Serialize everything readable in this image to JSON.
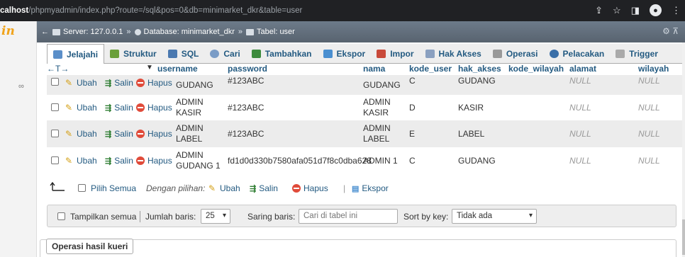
{
  "browser": {
    "url_host": "calhost",
    "url_path": "/phpmyadmin/index.php?route=/sql&pos=0&db=minimarket_dkr&table=user"
  },
  "sidebar": {
    "logo": "in"
  },
  "breadcrumb": {
    "server": "Server: 127.0.0.1",
    "database": "Database: minimarket_dkr",
    "table": "Tabel: user",
    "sep": "»"
  },
  "tabs": [
    {
      "label": "Jelajahi",
      "icon": "browse-icon",
      "color": "#5b8fc9"
    },
    {
      "label": "Struktur",
      "icon": "structure-icon",
      "color": "#6a9f3a"
    },
    {
      "label": "SQL",
      "icon": "sql-icon",
      "color": "#4b79b0"
    },
    {
      "label": "Cari",
      "icon": "search-icon",
      "color": "#7a9cc6"
    },
    {
      "label": "Tambahkan",
      "icon": "insert-icon",
      "color": "#3d8b3d"
    },
    {
      "label": "Ekspor",
      "icon": "export-icon",
      "color": "#4a8fd0"
    },
    {
      "label": "Impor",
      "icon": "import-icon",
      "color": "#c94a3a"
    },
    {
      "label": "Hak Akses",
      "icon": "privileges-icon",
      "color": "#8aa0c0"
    },
    {
      "label": "Operasi",
      "icon": "operations-icon",
      "color": "#999999"
    },
    {
      "label": "Pelacakan",
      "icon": "tracking-icon",
      "color": "#3a6fa8"
    },
    {
      "label": "Trigger",
      "icon": "trigger-icon",
      "color": "#aaaaaa"
    }
  ],
  "table": {
    "arrows": "←T→",
    "headers": [
      "username",
      "password",
      "nama",
      "kode_user",
      "hak_akses",
      "kode_wilayah",
      "alamat",
      "wilayah"
    ],
    "actions": {
      "edit": "Ubah",
      "copy": "Salin",
      "delete": "Hapus"
    },
    "rows": [
      {
        "username": "GUDANG",
        "password": "#123ABC",
        "nama": "GUDANG",
        "kode_user": "C",
        "hak_akses": "GUDANG",
        "alamat": "NULL",
        "wilayah": "NULL"
      },
      {
        "username": "ADMIN KASIR",
        "password": "#123ABC",
        "nama": "ADMIN KASIR",
        "kode_user": "D",
        "hak_akses": "KASIR",
        "alamat": "NULL",
        "wilayah": "NULL"
      },
      {
        "username": "ADMIN LABEL",
        "password": "#123ABC",
        "nama": "ADMIN LABEL",
        "kode_user": "E",
        "hak_akses": "LABEL",
        "alamat": "NULL",
        "wilayah": "NULL"
      },
      {
        "username": "ADMIN GUDANG 1",
        "password": "fd1d0d330b7580afa051d7f8c0dba628",
        "nama": "ADMIN 1",
        "kode_user": "C",
        "hak_akses": "GUDANG",
        "alamat": "NULL",
        "wilayah": "NULL"
      }
    ]
  },
  "bulk": {
    "select_all": "Pilih Semua",
    "with_selected": "Dengan pilihan:",
    "edit": "Ubah",
    "copy": "Salin",
    "delete": "Hapus",
    "sep": "|",
    "export": "Ekspor"
  },
  "options": {
    "show_all": "Tampilkan semua",
    "rows_label": "Jumlah baris:",
    "rows_value": "25",
    "filter_label": "Saring baris:",
    "filter_placeholder": "Cari di tabel ini",
    "sort_label": "Sort by key:",
    "sort_value": "Tidak ada"
  },
  "query_ops": {
    "legend": "Operasi hasil kueri"
  }
}
